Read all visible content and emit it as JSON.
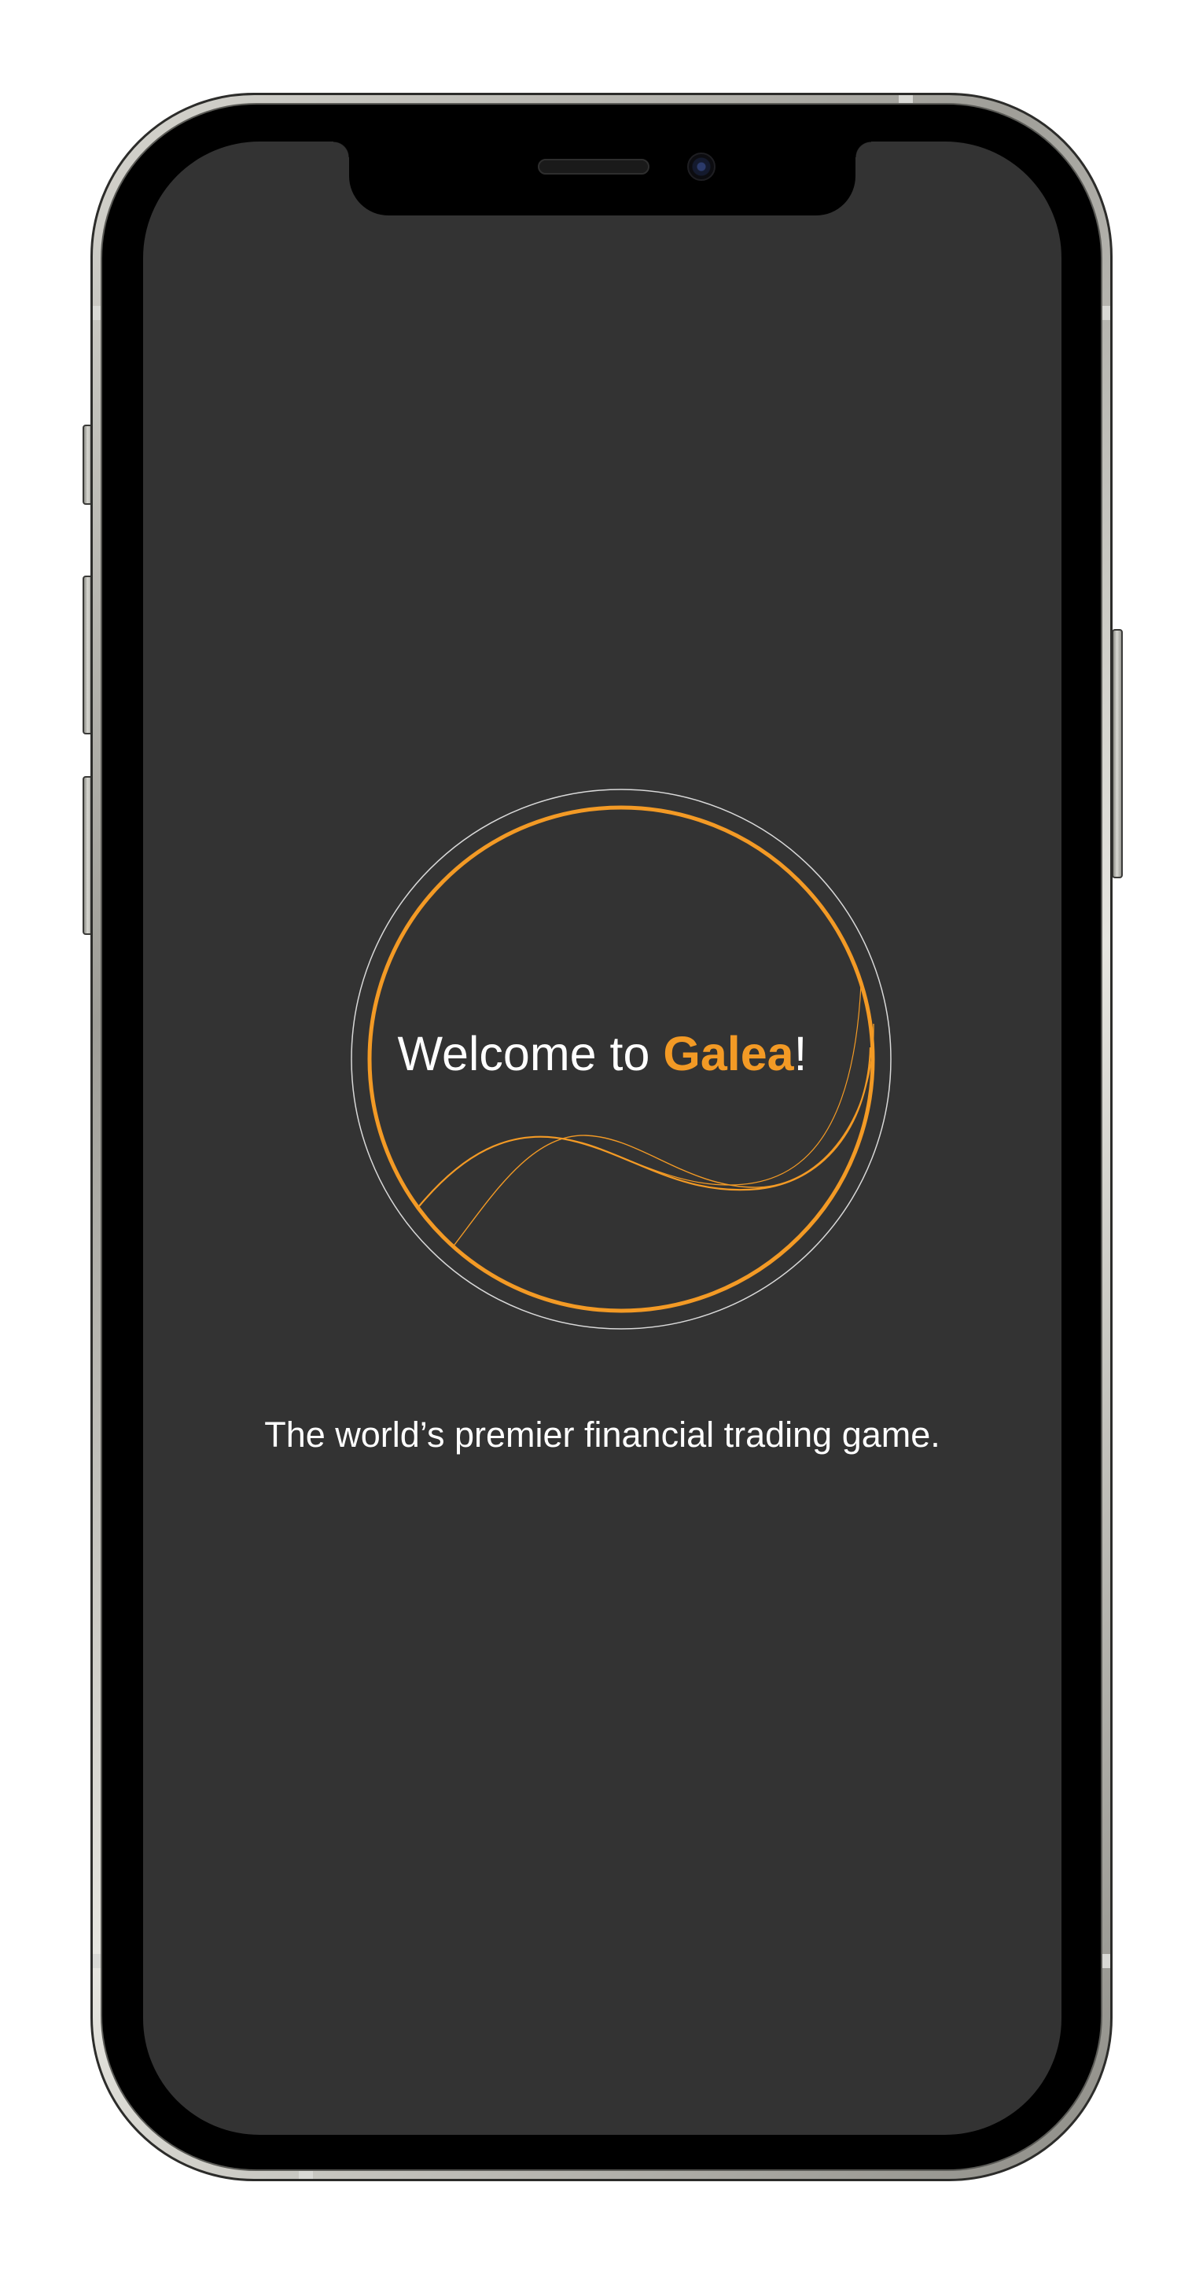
{
  "app": {
    "name": "Galea"
  },
  "welcome": {
    "prefix": "Welcome to ",
    "brand": "Galea",
    "suffix": "!"
  },
  "tagline": "The world’s premier financial trading game.",
  "icons": {
    "logo": "galea-circle-wave-logo",
    "speaker": "earpiece-speaker",
    "camera": "front-camera"
  },
  "colors": {
    "background": "#333333",
    "accent": "#f39a25",
    "text": "#ffffff",
    "outer_ring": "#d9d9d9"
  }
}
